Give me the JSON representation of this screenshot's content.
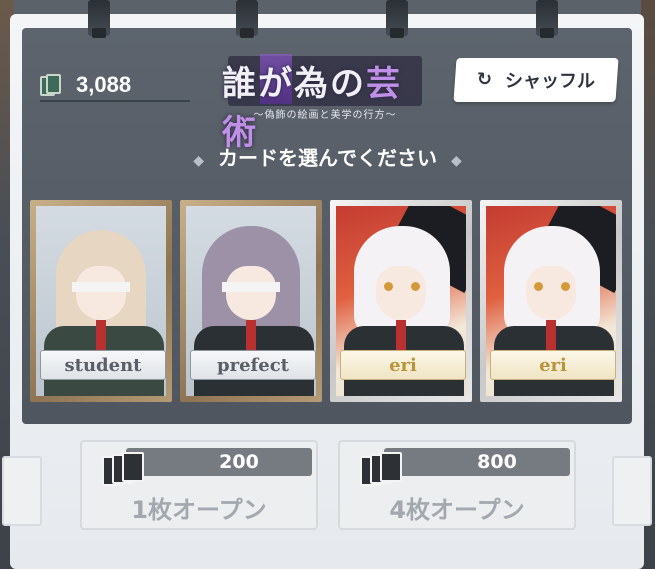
{
  "currency": {
    "value": "3,088",
    "icon": "card-stack-icon"
  },
  "logo": {
    "title_part1": "誰",
    "title_part2": "が",
    "title_part3": "為の",
    "title_part4": "芸術",
    "subtitle": "〜偽飾の絵画と美学の行方〜"
  },
  "shuffle": {
    "label": "シャッフル",
    "icon": "refresh-icon"
  },
  "instruction": {
    "text": "カードを選んでください",
    "deco": "◆"
  },
  "cards": [
    {
      "label": "student",
      "frame": "wood"
    },
    {
      "label": "prefect",
      "frame": "wood"
    },
    {
      "label": "eri",
      "frame": "silver"
    },
    {
      "label": "eri",
      "frame": "silver"
    }
  ],
  "open_buttons": [
    {
      "price": "200",
      "label": "1枚オープン"
    },
    {
      "price": "800",
      "label": "4枚オープン"
    }
  ],
  "colors": {
    "board": "#5d646d",
    "accent_purple": "#8a58c8",
    "button_disabled_text": "#a3a8ae"
  }
}
